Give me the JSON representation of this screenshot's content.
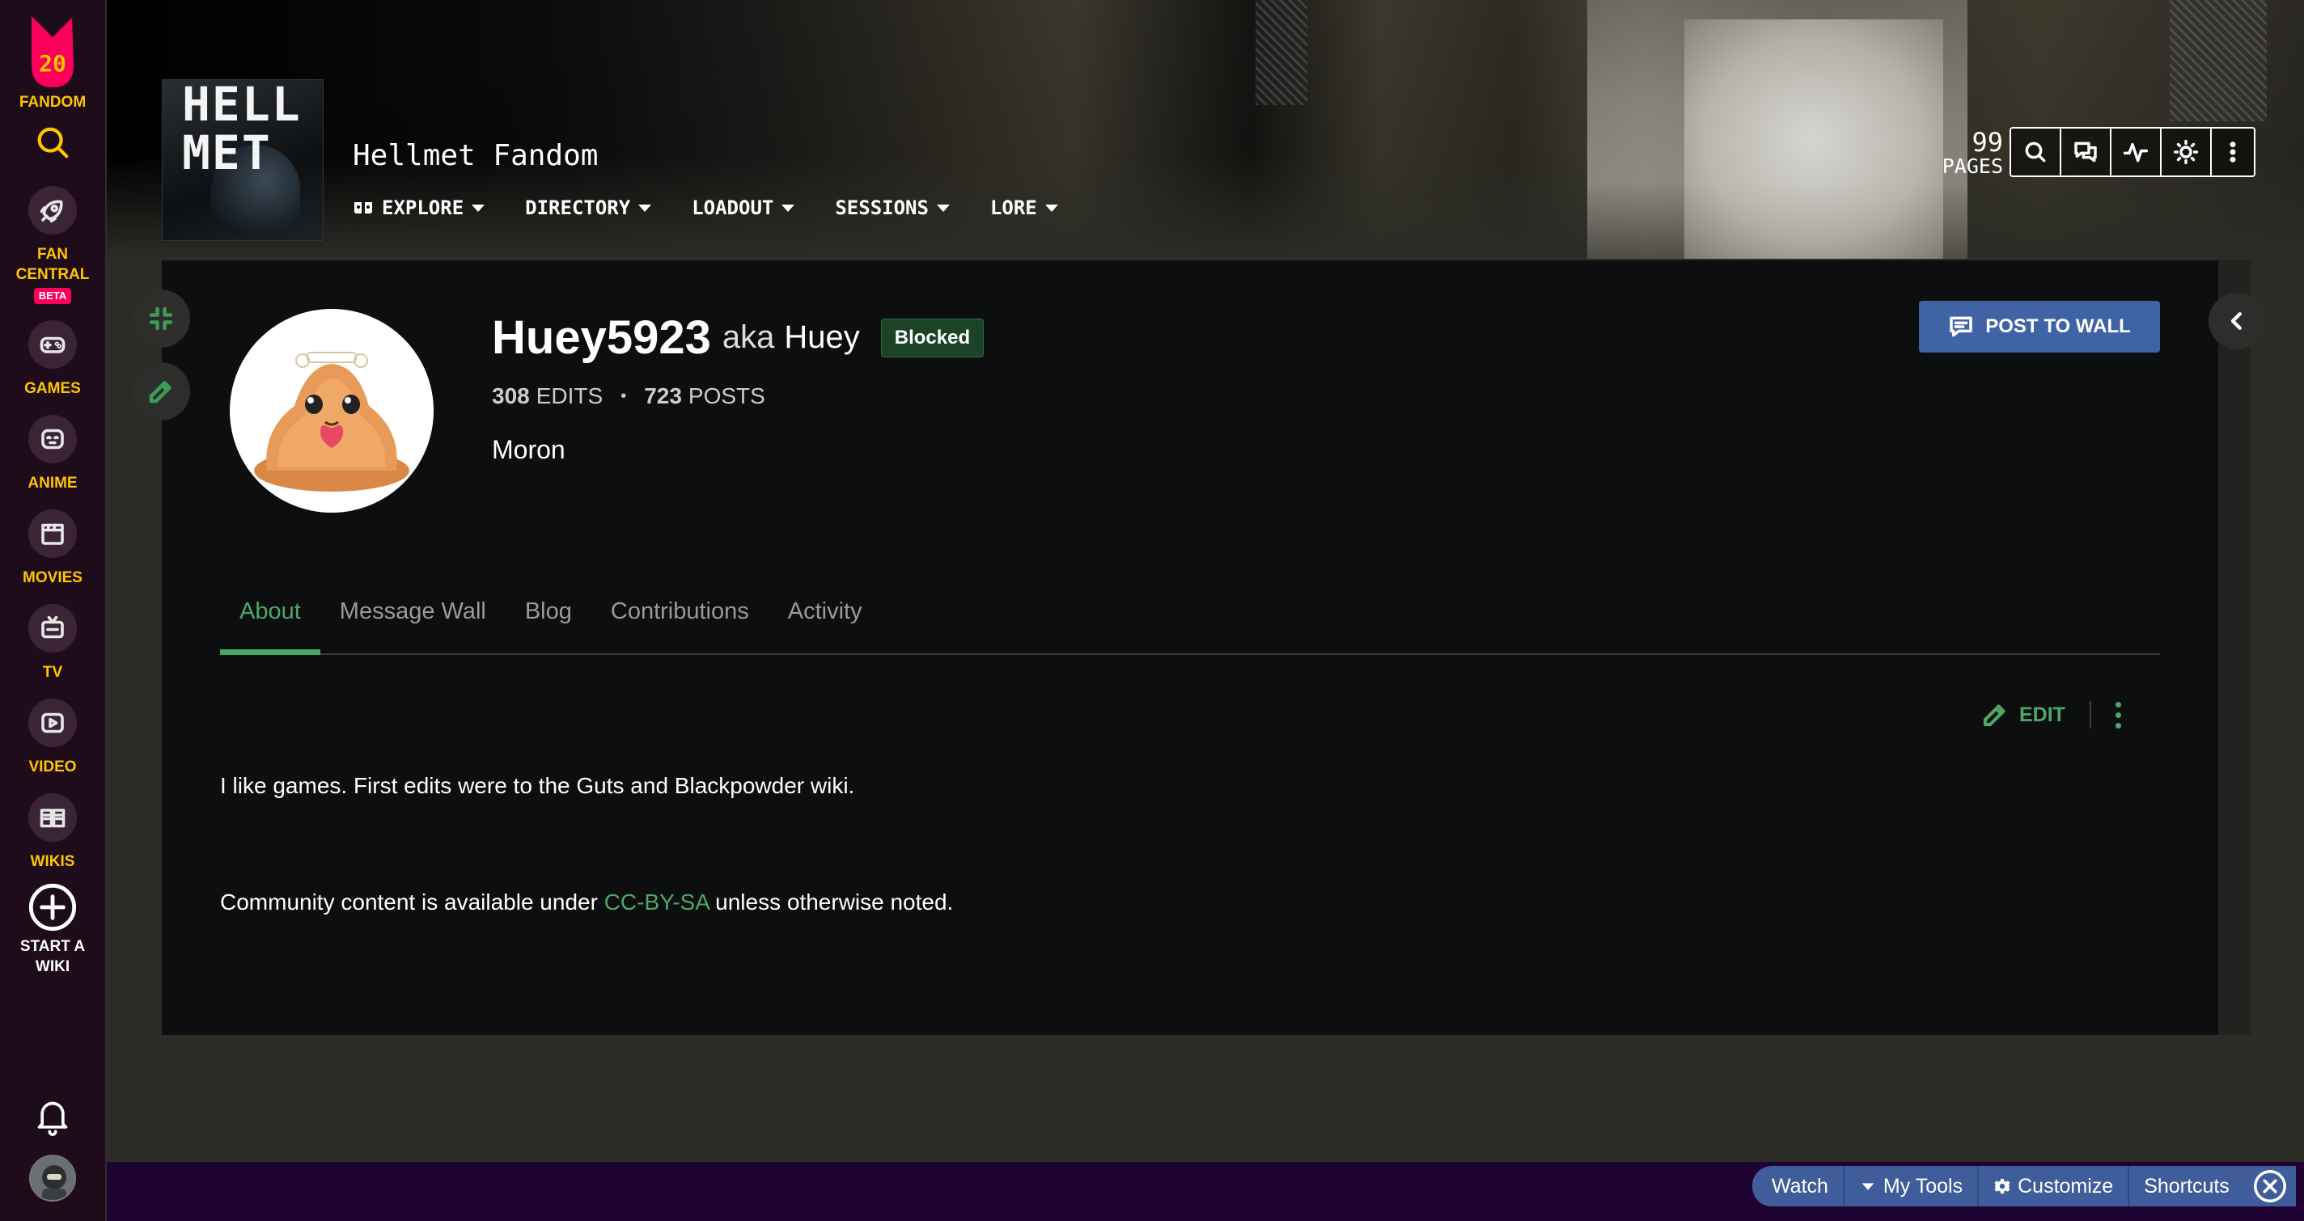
{
  "global_nav": {
    "logo_number": "20",
    "fandom_label": "FANDOM",
    "items": [
      {
        "label": "FAN\nCENTRAL",
        "icon": "rocket-icon"
      },
      {
        "label": "GAMES",
        "icon": "gamepad-icon"
      },
      {
        "label": "ANIME",
        "icon": "anime-face-icon"
      },
      {
        "label": "MOVIES",
        "icon": "clapperboard-icon"
      },
      {
        "label": "TV",
        "icon": "tv-icon"
      },
      {
        "label": "VIDEO",
        "icon": "video-play-icon"
      },
      {
        "label": "WIKIS",
        "icon": "book-icon"
      },
      {
        "label": "START A\nWIKI",
        "icon": "plus-circle-icon"
      }
    ],
    "beta_badge": "BETA"
  },
  "header": {
    "logo_text": "HELL\nMET",
    "wiki_title": "Hellmet Fandom",
    "nav": [
      {
        "label": "EXPLORE",
        "icon": "explore-icon"
      },
      {
        "label": "DIRECTORY"
      },
      {
        "label": "LOADOUT"
      },
      {
        "label": "SESSIONS"
      },
      {
        "label": "LORE"
      }
    ],
    "page_count": "99",
    "page_count_label": "PAGES"
  },
  "profile": {
    "username": "Huey5923",
    "aka_prefix": "aka",
    "aka_name": "Huey",
    "badge": "Blocked",
    "edits_count": "308",
    "edits_label": "EDITS",
    "posts_count": "723",
    "posts_label": "POSTS",
    "user_title": "Moron",
    "post_to_wall": "POST TO WALL"
  },
  "tabs": [
    "About",
    "Message Wall",
    "Blog",
    "Contributions",
    "Activity"
  ],
  "about": {
    "edit_label": "EDIT",
    "bio": "I like games. First edits were to the Guts and Blackpowder wiki."
  },
  "license": {
    "prefix": "Community content is available under ",
    "link": "CC-BY-SA",
    "suffix": " unless otherwise noted."
  },
  "bottom_tools": {
    "watch": "Watch",
    "my_tools": "My Tools",
    "customize": "Customize",
    "shortcuts": "Shortcuts"
  },
  "colors": {
    "accent_green": "#4fa765",
    "brand_gold": "#ffc500",
    "fandom_pink": "#fa005a",
    "button_blue": "#4063a6"
  }
}
